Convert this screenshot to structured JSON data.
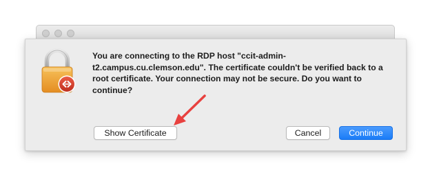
{
  "dialog": {
    "message": "You are connecting to the RDP host \"ccit-admin-t2.campus.cu.clemson.edu\". The certificate couldn't be verified back to a root certificate. Your connection may not be secure. Do you want to continue?",
    "show_certificate_label": "Show Certificate",
    "cancel_label": "Cancel",
    "continue_label": "Continue",
    "icon": "lock-with-remote-desktop-badge-icon"
  },
  "annotation": {
    "arrow_color": "#e8413f"
  },
  "colors": {
    "primary_button": "#1a7cf7",
    "lock_body": "#f0a53a",
    "badge": "#d8412f"
  }
}
